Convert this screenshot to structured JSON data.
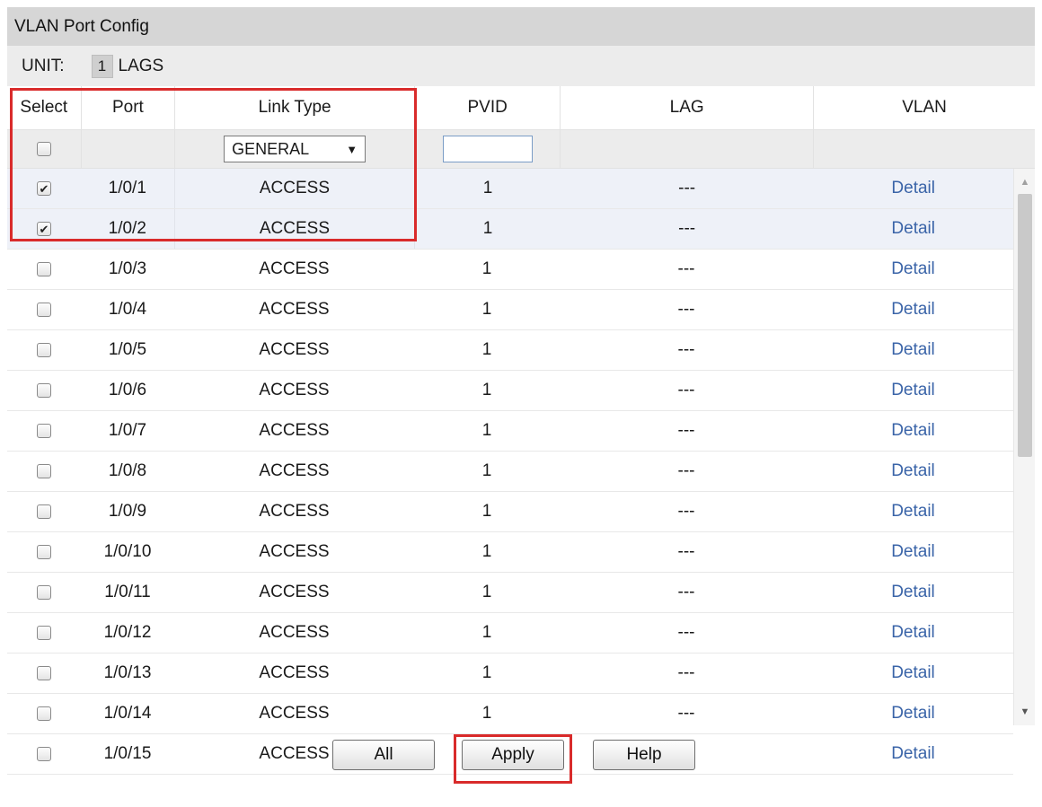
{
  "title": "VLAN Port Config",
  "unit": {
    "label": "UNIT:",
    "value": "1",
    "lags": "LAGS"
  },
  "headers": {
    "select": "Select",
    "port": "Port",
    "link_type": "Link Type",
    "pvid": "PVID",
    "lag": "LAG",
    "vlan": "VLAN"
  },
  "filter": {
    "link_type_selected": "GENERAL",
    "pvid_value": ""
  },
  "rows": [
    {
      "checked": true,
      "port": "1/0/1",
      "link_type": "ACCESS",
      "pvid": "1",
      "lag": "---",
      "vlan": "Detail"
    },
    {
      "checked": true,
      "port": "1/0/2",
      "link_type": "ACCESS",
      "pvid": "1",
      "lag": "---",
      "vlan": "Detail"
    },
    {
      "checked": false,
      "port": "1/0/3",
      "link_type": "ACCESS",
      "pvid": "1",
      "lag": "---",
      "vlan": "Detail"
    },
    {
      "checked": false,
      "port": "1/0/4",
      "link_type": "ACCESS",
      "pvid": "1",
      "lag": "---",
      "vlan": "Detail"
    },
    {
      "checked": false,
      "port": "1/0/5",
      "link_type": "ACCESS",
      "pvid": "1",
      "lag": "---",
      "vlan": "Detail"
    },
    {
      "checked": false,
      "port": "1/0/6",
      "link_type": "ACCESS",
      "pvid": "1",
      "lag": "---",
      "vlan": "Detail"
    },
    {
      "checked": false,
      "port": "1/0/7",
      "link_type": "ACCESS",
      "pvid": "1",
      "lag": "---",
      "vlan": "Detail"
    },
    {
      "checked": false,
      "port": "1/0/8",
      "link_type": "ACCESS",
      "pvid": "1",
      "lag": "---",
      "vlan": "Detail"
    },
    {
      "checked": false,
      "port": "1/0/9",
      "link_type": "ACCESS",
      "pvid": "1",
      "lag": "---",
      "vlan": "Detail"
    },
    {
      "checked": false,
      "port": "1/0/10",
      "link_type": "ACCESS",
      "pvid": "1",
      "lag": "---",
      "vlan": "Detail"
    },
    {
      "checked": false,
      "port": "1/0/11",
      "link_type": "ACCESS",
      "pvid": "1",
      "lag": "---",
      "vlan": "Detail"
    },
    {
      "checked": false,
      "port": "1/0/12",
      "link_type": "ACCESS",
      "pvid": "1",
      "lag": "---",
      "vlan": "Detail"
    },
    {
      "checked": false,
      "port": "1/0/13",
      "link_type": "ACCESS",
      "pvid": "1",
      "lag": "---",
      "vlan": "Detail"
    },
    {
      "checked": false,
      "port": "1/0/14",
      "link_type": "ACCESS",
      "pvid": "1",
      "lag": "---",
      "vlan": "Detail"
    },
    {
      "checked": false,
      "port": "1/0/15",
      "link_type": "ACCESS",
      "pvid": "1",
      "lag": "---",
      "vlan": "Detail"
    }
  ],
  "buttons": {
    "all": "All",
    "apply": "Apply",
    "help": "Help"
  },
  "colors": {
    "highlight": "#d92b2b",
    "link": "#3a64a8",
    "title_bar": "#d6d6d6",
    "checked_row": "#eef1f8"
  }
}
